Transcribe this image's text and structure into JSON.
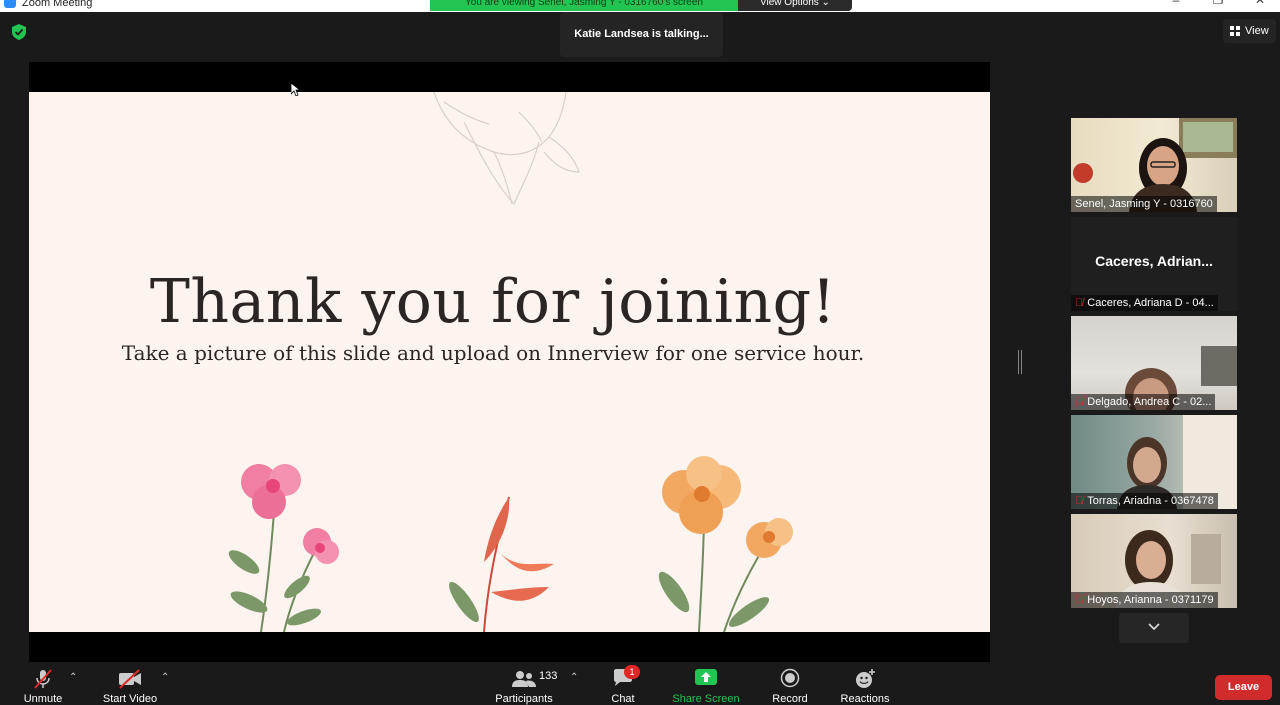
{
  "window": {
    "title": "Zoom Meeting"
  },
  "banner": {
    "viewing_text": "You are viewing Senel, Jasming Y - 0316760's screen",
    "view_options_label": "View Options"
  },
  "talking_indicator": "Katie Landsea is talking...",
  "view_button_label": "View",
  "slide": {
    "title": "Thank you for joining!",
    "subtitle": "Take a picture of this slide and upload on Innerview for one service hour."
  },
  "participants_tiles": [
    {
      "name": "Senel, Jasming Y - 0316760",
      "muted": false,
      "video": true
    },
    {
      "name": "Caceres, Adriana D - 04...",
      "display_name": "Caceres,  Adrian...",
      "muted": true,
      "video": false
    },
    {
      "name": "Delgado, Andrea C - 02...",
      "muted": true,
      "video": true
    },
    {
      "name": "Torras, Ariadna - 0367478",
      "muted": true,
      "video": true
    },
    {
      "name": "Hoyos, Arianna - 0371179",
      "muted": true,
      "video": true
    }
  ],
  "toolbar": {
    "unmute_label": "Unmute",
    "start_video_label": "Start Video",
    "participants_label": "Participants",
    "participants_count": "133",
    "chat_label": "Chat",
    "chat_badge": "1",
    "share_screen_label": "Share Screen",
    "record_label": "Record",
    "reactions_label": "Reactions",
    "leave_label": "Leave"
  },
  "colors": {
    "share_green": "#23c552",
    "leave_red": "#d02c2c",
    "slide_bg": "#fdf4f0",
    "toolbar_bg": "#1a1a1a"
  }
}
